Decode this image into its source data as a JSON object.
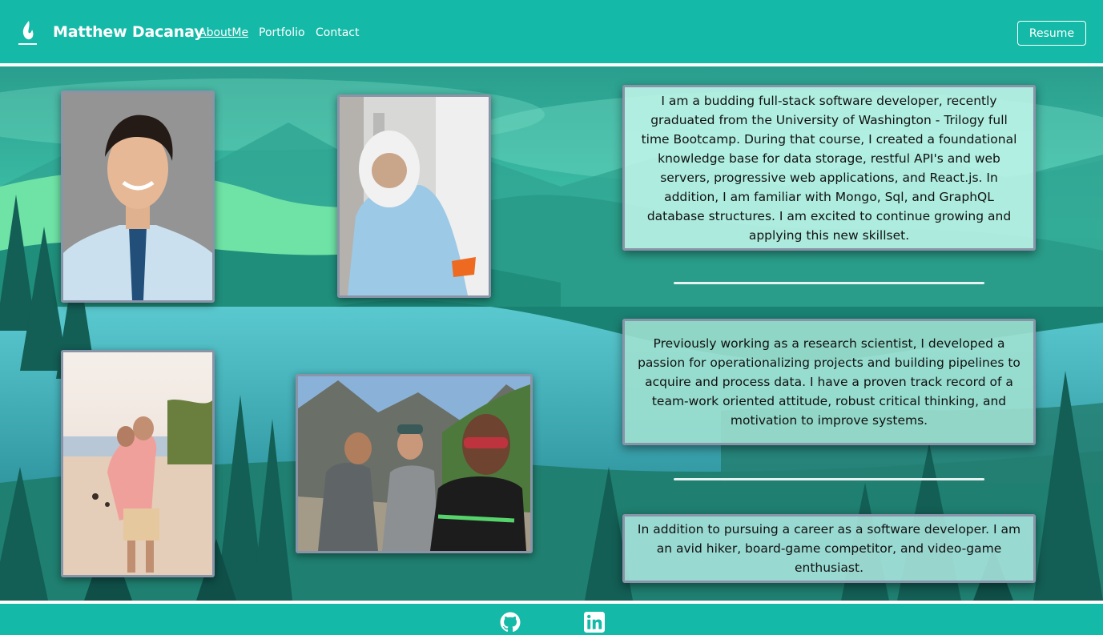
{
  "navbar": {
    "brand_name": "Matthew Dacanay",
    "links": [
      {
        "label": "AboutMe",
        "active": true
      },
      {
        "label": "Portfolio",
        "active": false
      },
      {
        "label": "Contact",
        "active": false
      }
    ],
    "resume_label": "Resume"
  },
  "about": {
    "paragraphs": [
      "I am a budding full-stack software developer, recently graduated from the University of Washington - Trilogy full time Bootcamp. During that course, I created a foundational knowledge base for data storage, restful API's and web servers, progressive web applications, and React.js. In addition, I am familiar with Mongo, Sql, and GraphQL database structures. I am excited to continue growing and applying this new skillset.",
      "Previously working as a research scientist, I developed a passion for operationalizing projects and building pipelines to acquire and process data. I have a proven track record of a team-work oriented attitude, robust critical thinking, and motivation to improve systems.",
      "In addition to pursuing a career as a software developer. I am an avid hiker, board-game competitor, and video-game enthusiast."
    ]
  },
  "footer": {
    "icons": [
      "github-icon",
      "linkedin-icon"
    ]
  },
  "colors": {
    "brand": "#14b9a7",
    "card_border": "#8a94a8"
  }
}
